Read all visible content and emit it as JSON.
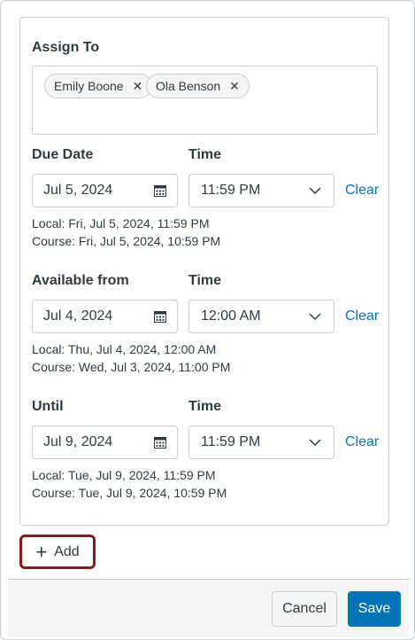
{
  "assign": {
    "label": "Assign To",
    "chips": [
      {
        "name": "Emily Boone"
      },
      {
        "name": "Ola Benson"
      }
    ]
  },
  "due": {
    "date_label": "Due Date",
    "time_label": "Time",
    "date": "Jul 5, 2024",
    "time": "11:59 PM",
    "clear": "Clear",
    "local": "Local: Fri, Jul 5, 2024, 11:59 PM",
    "course": "Course: Fri, Jul 5, 2024, 10:59 PM"
  },
  "available": {
    "date_label": "Available from",
    "time_label": "Time",
    "date": "Jul 4, 2024",
    "time": "12:00 AM",
    "clear": "Clear",
    "local": "Local: Thu, Jul 4, 2024, 12:00 AM",
    "course": "Course: Wed, Jul 3, 2024, 11:00 PM"
  },
  "until": {
    "date_label": "Until",
    "time_label": "Time",
    "date": "Jul 9, 2024",
    "time": "11:59 PM",
    "clear": "Clear",
    "local": "Local: Tue, Jul 9, 2024, 11:59 PM",
    "course": "Course: Tue, Jul 9, 2024, 10:59 PM"
  },
  "add_label": "Add",
  "footer": {
    "cancel": "Cancel",
    "save": "Save"
  },
  "colors": {
    "accent": "#0374b5",
    "highlight": "#8b1a1a",
    "border": "#c7cdd1"
  },
  "icons": {
    "remove": "close-icon",
    "date": "calendar-icon",
    "time": "chevron-down-icon",
    "add": "plus-icon"
  }
}
